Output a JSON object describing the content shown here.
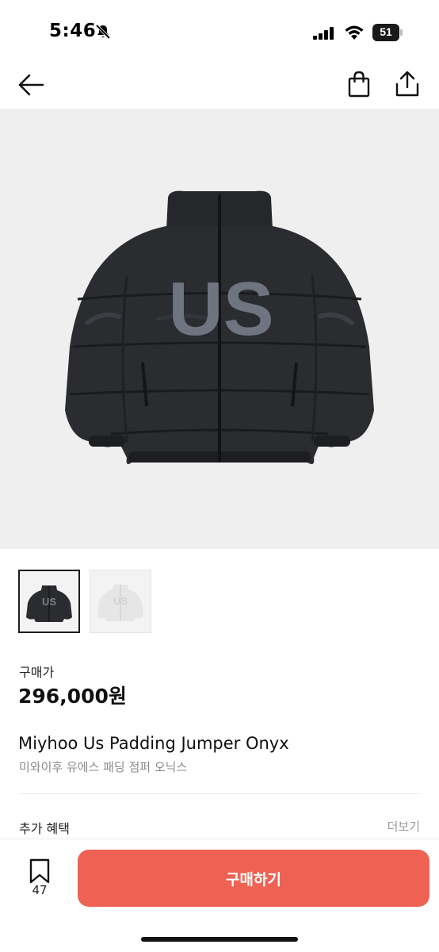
{
  "status": {
    "time": "5:46",
    "battery": "51",
    "icons": [
      "bell-slash-icon",
      "signal-icon",
      "wifi-icon",
      "battery-icon"
    ]
  },
  "nav": {
    "icons": [
      "back-arrow-icon",
      "shopping-bag-icon",
      "share-icon"
    ]
  },
  "product": {
    "image_text": "US",
    "thumb_1_text": "US",
    "thumb_2_text": "US",
    "price_label": "구매가",
    "price": "296,000원",
    "name_en": "Miyhoo Us Padding Jumper Onyx",
    "name_ko": "미와이후 유에스 패딩 점퍼 오닉스"
  },
  "benefits": {
    "label": "추가 혜택",
    "more": "더보기"
  },
  "bottom": {
    "bookmark_count": "47",
    "buy_label": "구매하기"
  },
  "colors": {
    "buy_button": "#ef6253",
    "image_background": "#efefef",
    "jacket": "#2a2c30",
    "jacket_white": "#e8e8e8"
  }
}
